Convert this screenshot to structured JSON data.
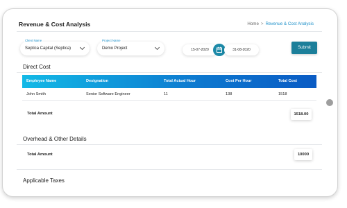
{
  "page": {
    "title": "Revenue & Cost Analysis"
  },
  "breadcrumb": {
    "home": "Home",
    "separator": ">",
    "current": "Revenue & Cost Analysis"
  },
  "filters": {
    "client": {
      "label": "Client Name",
      "value": "Septica Capital (Septica)"
    },
    "project": {
      "label": "Project Name",
      "value": "Demo Project"
    },
    "date_from": "15-07-2020",
    "date_to": "31-08-2020",
    "submit_label": "Submit"
  },
  "direct_cost": {
    "title": "Direct Cost",
    "columns": [
      "Employee Name",
      "Designation",
      "Total Actual Hour",
      "Cost Per Hour",
      "Total Cost"
    ],
    "rows": [
      [
        "John Smith",
        "Senior Software Engineer",
        "11",
        "138",
        "1518"
      ]
    ],
    "total_label": "Total Amount",
    "total_value": "1518.00"
  },
  "overhead": {
    "title": "Overhead & Other Details",
    "total_label": "Total Amount",
    "total_value": "10000"
  },
  "taxes": {
    "title": "Applicable Taxes"
  },
  "colors": {
    "accent": "#1a8ec8",
    "submit": "#1c7f9a",
    "header_start": "#13b9e6",
    "header_end": "#0a5bc4"
  }
}
